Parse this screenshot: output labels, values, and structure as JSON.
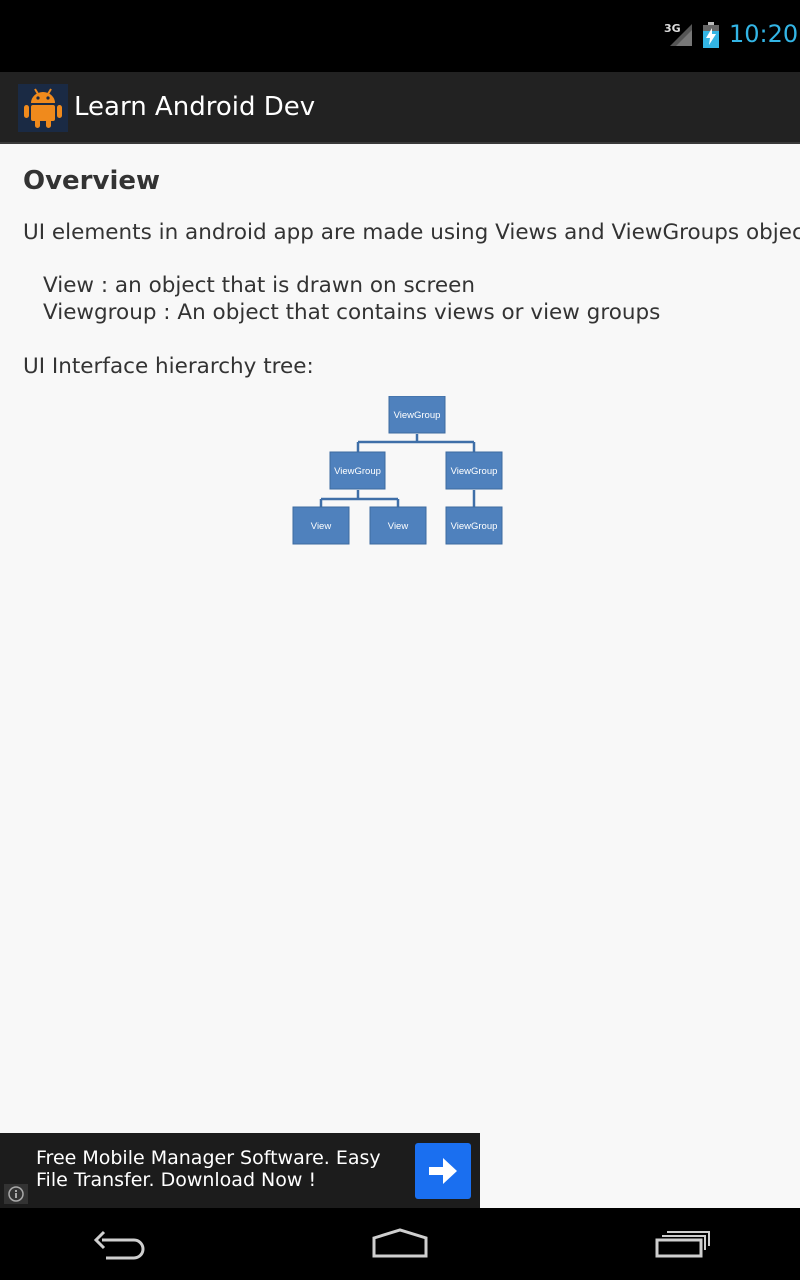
{
  "status_bar": {
    "network": "3G",
    "time": "10:20",
    "icons": [
      "signal-icon",
      "battery-charging-icon"
    ],
    "clock_color": "#33b5e5"
  },
  "action_bar": {
    "title": "Learn Android Dev",
    "icon": "android-robot-icon"
  },
  "content": {
    "heading": "Overview",
    "intro": "UI elements in android app are made using Views and ViewGroups objects.",
    "definitions": [
      "View : an object that is drawn on screen",
      "Viewgroup : An object that contains views or view groups"
    ],
    "tree_label": "UI Interface hierarchy tree:",
    "diagram": {
      "node_color": "#4f81bd",
      "nodes": [
        "ViewGroup",
        "ViewGroup",
        "ViewGroup",
        "View",
        "View",
        "ViewGroup"
      ]
    }
  },
  "ad": {
    "text": "Free Mobile Manager Software. Easy File Transfer. Download Now !",
    "button_icon": "arrow-right-icon",
    "info_icon": "info-icon",
    "button_color": "#1a6ff0"
  },
  "nav_bar": {
    "icons": [
      "back-icon",
      "home-icon",
      "recent-apps-icon"
    ]
  }
}
